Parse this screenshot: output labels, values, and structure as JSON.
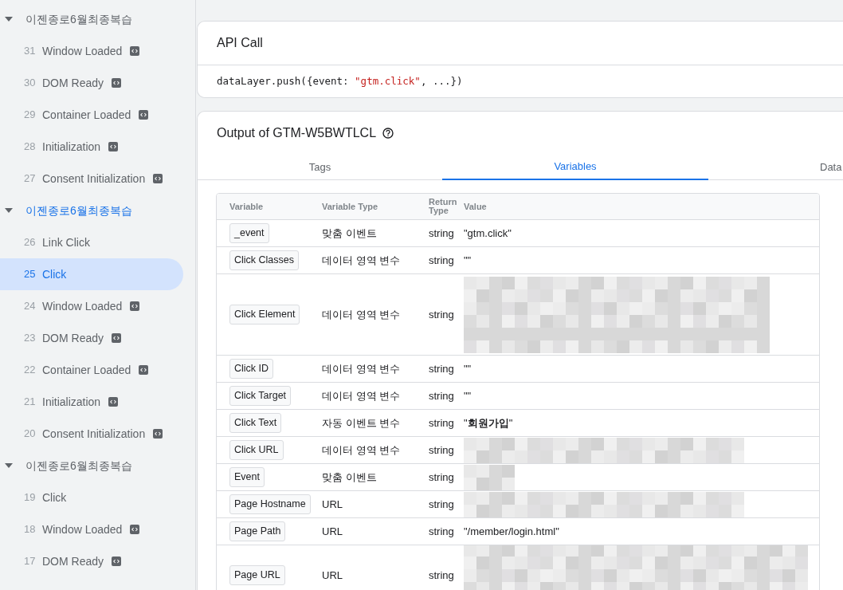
{
  "sidebar": {
    "groups": [
      {
        "label": "이젠종로6월최종복습",
        "expanded": true,
        "selected": false,
        "items": [
          {
            "number": "31",
            "label": "Window Loaded",
            "code_badge": true,
            "selected": false
          },
          {
            "number": "30",
            "label": "DOM Ready",
            "code_badge": true,
            "selected": false
          },
          {
            "number": "29",
            "label": "Container Loaded",
            "code_badge": true,
            "selected": false
          },
          {
            "number": "28",
            "label": "Initialization",
            "code_badge": true,
            "selected": false
          },
          {
            "number": "27",
            "label": "Consent Initialization",
            "code_badge": true,
            "selected": false
          }
        ]
      },
      {
        "label": "이젠종로6월최종복습",
        "expanded": true,
        "selected": true,
        "items": [
          {
            "number": "26",
            "label": "Link Click",
            "code_badge": false,
            "selected": false
          },
          {
            "number": "25",
            "label": "Click",
            "code_badge": false,
            "selected": true
          },
          {
            "number": "24",
            "label": "Window Loaded",
            "code_badge": true,
            "selected": false
          },
          {
            "number": "23",
            "label": "DOM Ready",
            "code_badge": true,
            "selected": false
          },
          {
            "number": "22",
            "label": "Container Loaded",
            "code_badge": true,
            "selected": false
          },
          {
            "number": "21",
            "label": "Initialization",
            "code_badge": true,
            "selected": false
          },
          {
            "number": "20",
            "label": "Consent Initialization",
            "code_badge": true,
            "selected": false
          }
        ]
      },
      {
        "label": "이젠종로6월최종복습",
        "expanded": true,
        "selected": false,
        "items": [
          {
            "number": "19",
            "label": "Click",
            "code_badge": false,
            "selected": false
          },
          {
            "number": "18",
            "label": "Window Loaded",
            "code_badge": true,
            "selected": false
          },
          {
            "number": "17",
            "label": "DOM Ready",
            "code_badge": true,
            "selected": false
          }
        ]
      }
    ]
  },
  "api_call": {
    "title": "API Call",
    "code_prefix": "dataLayer.push({event: ",
    "code_string": "\"gtm.click\"",
    "code_suffix": ", ...})"
  },
  "output": {
    "title": "Output of GTM-W5BWTLCL",
    "tabs": [
      {
        "label": "Tags",
        "selected": false
      },
      {
        "label": "Variables",
        "selected": true
      },
      {
        "label": "Data",
        "selected": false
      }
    ],
    "table": {
      "columns": [
        "Variable",
        "Variable Type",
        "Return Type",
        "Value"
      ],
      "rows": [
        {
          "variable": "_event",
          "type": "맞춤 이벤트",
          "return_type": "string",
          "kind": "text",
          "value": "\"gtm.click\""
        },
        {
          "variable": "Click Classes",
          "type": "데이터 영역 변수",
          "return_type": "string",
          "kind": "text",
          "value": "\"\""
        },
        {
          "variable": "Click Element",
          "type": "데이터 영역 변수",
          "return_type": "string",
          "kind": "redacted_tall"
        },
        {
          "variable": "Click ID",
          "type": "데이터 영역 변수",
          "return_type": "string",
          "kind": "text",
          "value": "\"\""
        },
        {
          "variable": "Click Target",
          "type": "데이터 영역 변수",
          "return_type": "string",
          "kind": "text",
          "value": "\"\""
        },
        {
          "variable": "Click Text",
          "type": "자동 이벤트 변수",
          "return_type": "string",
          "kind": "text",
          "value": "\"**회원가입**\""
        },
        {
          "variable": "Click URL",
          "type": "데이터 영역 변수",
          "return_type": "string",
          "kind": "redacted"
        },
        {
          "variable": "Event",
          "type": "맞춤 이벤트",
          "return_type": "string",
          "kind": "redacted_short"
        },
        {
          "variable": "Page Hostname",
          "type": "URL",
          "return_type": "string",
          "kind": "redacted"
        },
        {
          "variable": "Page Path",
          "type": "URL",
          "return_type": "string",
          "kind": "text",
          "value": "\"/member/login.html\""
        },
        {
          "variable": "Page URL",
          "type": "URL",
          "return_type": "string",
          "kind": "redacted_cut"
        }
      ]
    }
  }
}
